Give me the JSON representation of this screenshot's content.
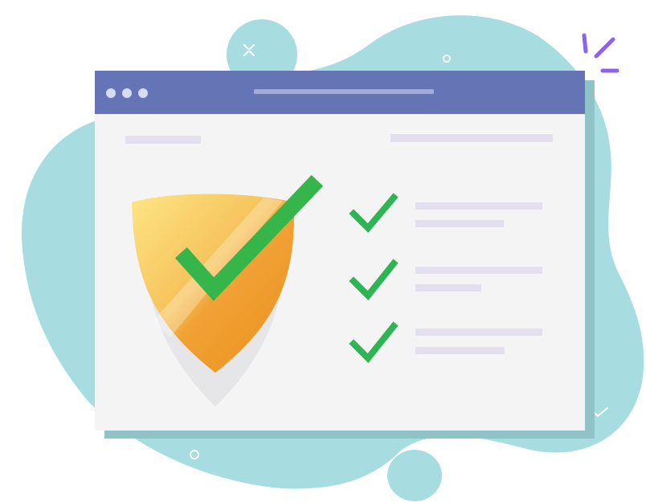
{
  "illustration": {
    "subject": "security-verified-browser-window",
    "checklist": [
      {
        "checked": true
      },
      {
        "checked": true
      },
      {
        "checked": true
      }
    ],
    "window_controls": [
      "dot",
      "dot",
      "dot"
    ]
  },
  "colors": {
    "blob": "#a7dde1",
    "window_titlebar": "#6574b4",
    "window_titlebar_line": "#a3abd8",
    "window_body": "#f4f4f5",
    "window_shadow": "#8fc3c8",
    "placeholder_line": "#e4dfee",
    "check_green": "#2db553",
    "shield_gold_light": "#fde585",
    "shield_orange": "#ef9423",
    "shield_shadow": "#e6e6e8",
    "sparkle_purple": "#8c63ec"
  },
  "icons": {
    "hero": "shield-check-icon",
    "list_marker": "checkmark-icon",
    "sparkle": "sparkle-icon"
  }
}
